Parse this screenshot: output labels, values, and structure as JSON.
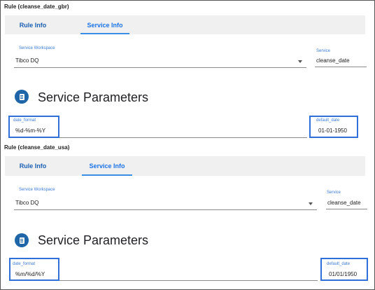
{
  "panels": [
    {
      "rule_title": "Rule (cleanse_date_gbr)",
      "tabs": [
        {
          "label": "Rule Info",
          "active": false
        },
        {
          "label": "Service Info",
          "active": true
        }
      ],
      "service_workspace": {
        "label": "Service Workspace",
        "value": "Tibco DQ"
      },
      "service": {
        "label": "Service",
        "value": "cleanse_date"
      },
      "section_title": "Service Parameters",
      "date_format": {
        "label": "date_format",
        "value": "%d-%m-%Y"
      },
      "default_date": {
        "label": "default_date",
        "value": "01-01-1950"
      }
    },
    {
      "rule_title": "Rule (cleanse_date_usa)",
      "tabs": [
        {
          "label": "Rule Info",
          "active": false
        },
        {
          "label": "Service Info",
          "active": true
        }
      ],
      "service_workspace": {
        "label": "Service Workspace",
        "value": "Tibco DQ"
      },
      "service": {
        "label": "Service",
        "value": "cleanse_date"
      },
      "section_title": "Service Parameters",
      "date_format": {
        "label": "date_format",
        "value": "%m/%d/%Y"
      },
      "default_date": {
        "label": "default_date",
        "value": "01/01/1950"
      }
    }
  ],
  "colors": {
    "accent": "#1a73e8",
    "highlight": "#2e6fd9",
    "icon_bg": "#1e66a8"
  },
  "icons": {
    "section": "document-icon",
    "dropdown": "chevron-down-icon"
  }
}
